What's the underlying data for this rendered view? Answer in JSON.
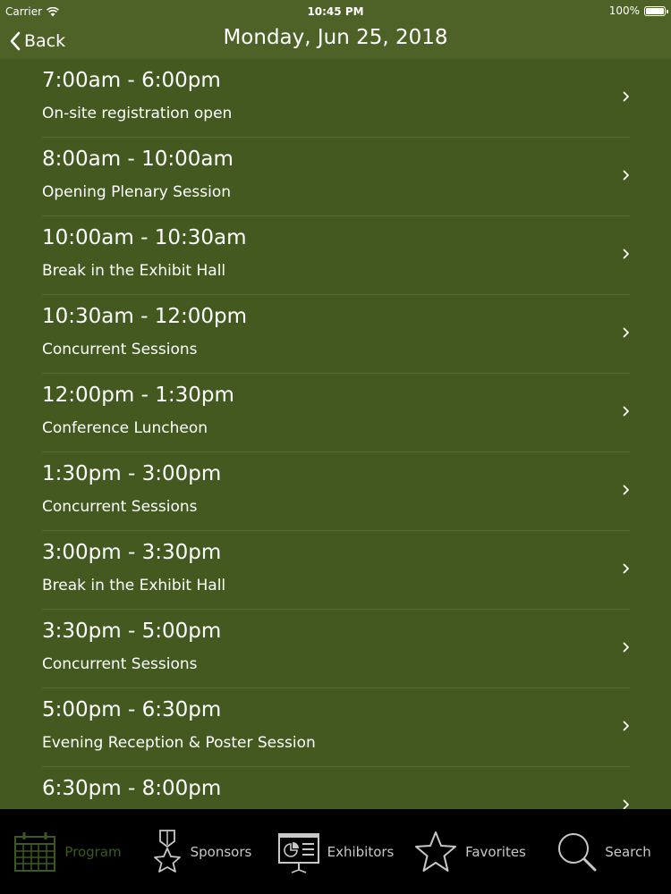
{
  "status_bar": {
    "carrier": "Carrier",
    "time": "10:45 PM",
    "battery": "100%",
    "battery_level": 1.0
  },
  "nav": {
    "back_label": "Back",
    "title": "Monday, Jun 25, 2018"
  },
  "schedule": [
    {
      "time": "7:00am - 6:00pm",
      "title": "On-site registration open"
    },
    {
      "time": "8:00am - 10:00am",
      "title": "Opening Plenary Session"
    },
    {
      "time": "10:00am - 10:30am",
      "title": "Break in the Exhibit Hall"
    },
    {
      "time": "10:30am - 12:00pm",
      "title": "Concurrent Sessions"
    },
    {
      "time": "12:00pm - 1:30pm",
      "title": "Conference Luncheon"
    },
    {
      "time": "1:30pm - 3:00pm",
      "title": "Concurrent Sessions"
    },
    {
      "time": "3:00pm - 3:30pm",
      "title": "Break in the Exhibit Hall"
    },
    {
      "time": "3:30pm - 5:00pm",
      "title": "Concurrent Sessions"
    },
    {
      "time": "5:00pm - 6:30pm",
      "title": "Evening Reception & Poster Session"
    },
    {
      "time": "6:30pm - 8:00pm",
      "title": ""
    }
  ],
  "tabs": [
    {
      "label": "Program",
      "icon": "calendar-icon",
      "active": true
    },
    {
      "label": "Sponsors",
      "icon": "award-ribbon-icon",
      "active": false
    },
    {
      "label": "Exhibitors",
      "icon": "presentation-board-icon",
      "active": false
    },
    {
      "label": "Favorites",
      "icon": "star-icon",
      "active": false
    },
    {
      "label": "Search",
      "icon": "search-icon",
      "active": false
    }
  ],
  "colors": {
    "background": "#44591f",
    "bar": "#4e6228",
    "separator": "#576c30",
    "tab_active": "#3c5a1d",
    "tab_inactive": "#c8c8c8"
  }
}
